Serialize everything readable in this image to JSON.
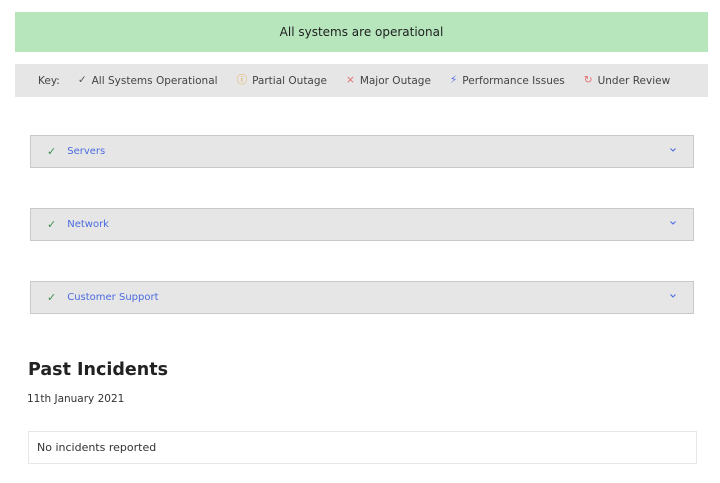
{
  "banner": {
    "text": "All systems are operational",
    "color": "#b7e6bd"
  },
  "key": {
    "label": "Key:",
    "items": [
      {
        "icon": "check-icon",
        "glyph": "✓",
        "text": "All Systems Operational"
      },
      {
        "icon": "partial-outage-icon",
        "glyph": "ⓘ",
        "text": "Partial Outage"
      },
      {
        "icon": "major-outage-icon",
        "glyph": "×",
        "text": "Major Outage"
      },
      {
        "icon": "performance-issues-icon",
        "glyph": "⚡",
        "text": "Performance Issues"
      },
      {
        "icon": "under-review-icon",
        "glyph": "↻",
        "text": "Under Review"
      }
    ]
  },
  "sections": [
    {
      "status_glyph": "✓",
      "label": "Servers"
    },
    {
      "status_glyph": "✓",
      "label": "Network"
    },
    {
      "status_glyph": "✓",
      "label": "Customer Support"
    }
  ],
  "past_incidents": {
    "title": "Past Incidents",
    "date": "11th January 2021",
    "message": "No incidents reported"
  }
}
